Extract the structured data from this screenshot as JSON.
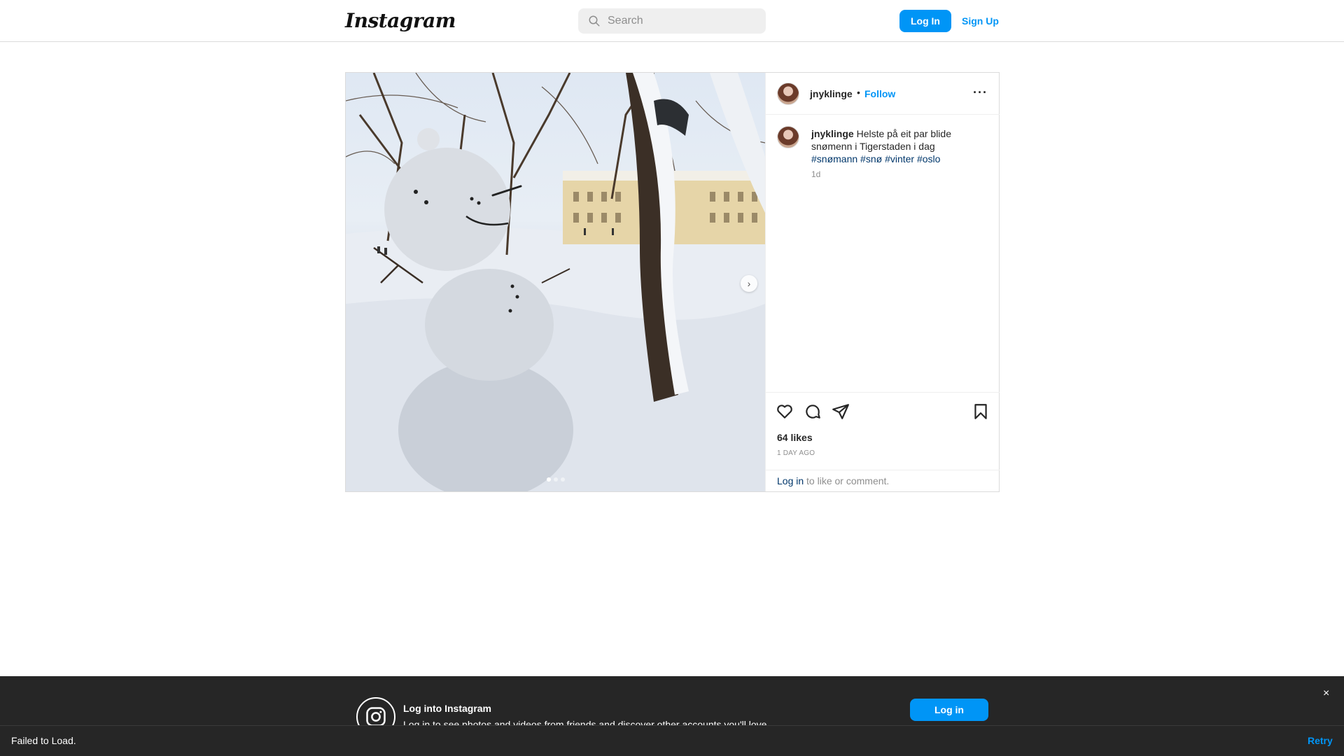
{
  "nav": {
    "logo": "Instagram",
    "search_placeholder": "Search",
    "login_label": "Log In",
    "signup_label": "Sign Up"
  },
  "post": {
    "username": "jnyklinge",
    "separator": "•",
    "follow_label": "Follow",
    "more_label": "···",
    "caption_text": "Helste på eit par blide snømenn i Tigerstaden i dag",
    "hashtags": [
      "#snømann",
      "#snø",
      "#vinter",
      "#oslo"
    ],
    "caption_time": "1d",
    "likes": "64 likes",
    "time_ago": "1 DAY AGO",
    "login_link": "Log in",
    "login_suffix": " to like or comment.",
    "carousel": {
      "current": 1,
      "total": 3
    },
    "icons": [
      "heart-icon",
      "comment-icon",
      "share-icon",
      "bookmark-icon"
    ]
  },
  "banner": {
    "title": "Log into Instagram",
    "subtitle": "Log in to see photos and videos from friends and discover other accounts you'll love.",
    "login_label": "Log in",
    "close_label": "×"
  },
  "toast": {
    "message": "Failed to Load.",
    "retry_label": "Retry"
  },
  "colors": {
    "accent": "#0095f6",
    "hashtag": "#00376b",
    "muted": "#8e8e8e",
    "banner_bg": "#262626"
  }
}
